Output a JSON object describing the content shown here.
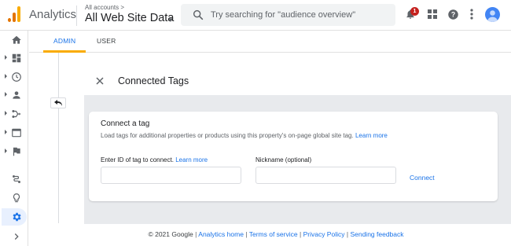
{
  "header": {
    "brand": "Analytics",
    "account_crumb": "All accounts >",
    "account_name": "All Web Site Data",
    "search_placeholder": "Try searching for \"audience overview\"",
    "notification_count": "1",
    "icons": [
      "notifications-icon",
      "apps-icon",
      "help-icon",
      "more-vert-icon",
      "account-icon"
    ],
    "logo_colors": [
      "#f9ab00",
      "#e37400"
    ]
  },
  "sidebar": {
    "items": [
      {
        "name": "home",
        "icon": "home-icon",
        "expandable": false
      },
      {
        "name": "customization",
        "icon": "dashboard-icon",
        "expandable": true
      },
      {
        "name": "realtime",
        "icon": "clock-icon",
        "expandable": true
      },
      {
        "name": "audience",
        "icon": "person-icon",
        "expandable": true
      },
      {
        "name": "acquisition",
        "icon": "acquisition-icon",
        "expandable": true
      },
      {
        "name": "behavior",
        "icon": "behavior-icon",
        "expandable": true
      },
      {
        "name": "conversions",
        "icon": "flag-icon",
        "expandable": true
      },
      {
        "name": "attribution",
        "icon": "attribution-icon",
        "expandable": false
      },
      {
        "name": "discover",
        "icon": "lightbulb-icon",
        "expandable": false
      },
      {
        "name": "admin",
        "icon": "gear-icon",
        "expandable": false,
        "active": true
      },
      {
        "name": "expand",
        "icon": "chevron-right-icon",
        "expandable": false
      }
    ]
  },
  "tabs": {
    "admin": "ADMIN",
    "user": "USER",
    "active": "admin",
    "accent": "#f9ab00"
  },
  "panel": {
    "title": "Connected Tags"
  },
  "card": {
    "title": "Connect a tag",
    "description": "Load tags for additional properties or products using this property's on-page global site tag.",
    "description_link": "Learn more",
    "id_label": "Enter ID of tag to connect.",
    "id_link": "Learn more",
    "id_value": "",
    "nickname_label": "Nickname (optional)",
    "nickname_value": "",
    "connect_label": "Connect"
  },
  "footer": {
    "copyright": "© 2021 Google",
    "links": [
      "Analytics home",
      "Terms of service",
      "Privacy Policy",
      "Sending feedback"
    ]
  },
  "colors": {
    "primary_blue": "#1a73e8",
    "badge_red": "#c5221f",
    "content_gray": "#e8eaed"
  }
}
